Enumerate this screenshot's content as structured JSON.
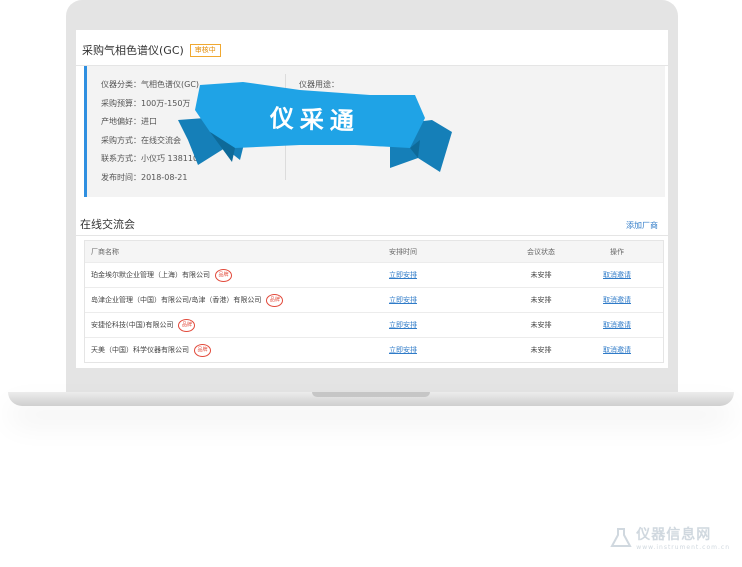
{
  "page": {
    "title": "采购气相色谱仪(GC)",
    "status_badge": "审核中"
  },
  "info": {
    "category": "仪器分类：气相色谱仪(GC)",
    "budget": "采购预算：100万-150万",
    "origin": "产地偏好：进口",
    "method": "采购方式：在线交流会",
    "contact": "联系方式：小仪巧  1381103",
    "date": "发布时间：2018-08-21",
    "usage": "仪器用途："
  },
  "ribbon": {
    "text": "仪采通",
    "color": "#1fa3e6"
  },
  "section": {
    "title": "在线交流会",
    "add_label": "添加厂商"
  },
  "table": {
    "headers": [
      "厂商名称",
      "安排时间",
      "会议状态",
      "操作"
    ],
    "rows": [
      {
        "vendor": "珀金埃尔默企业管理（上海）有限公司",
        "schedule": "立即安排",
        "status": "未安排",
        "action": "取消邀请"
      },
      {
        "vendor": "岛津企业管理（中国）有限公司/岛津（香港）有限公司",
        "schedule": "立即安排",
        "status": "未安排",
        "action": "取消邀请"
      },
      {
        "vendor": "安捷伦科技(中国)有限公司",
        "schedule": "立即安排",
        "status": "未安排",
        "action": "取消邀请"
      },
      {
        "vendor": "天美（中国）科学仪器有限公司",
        "schedule": "立即安排",
        "status": "未安排",
        "action": "取消邀请"
      }
    ],
    "seal_text": "品牌"
  },
  "watermark": {
    "logo": "仪器信息网",
    "url": "www.instrument.com.cn"
  }
}
